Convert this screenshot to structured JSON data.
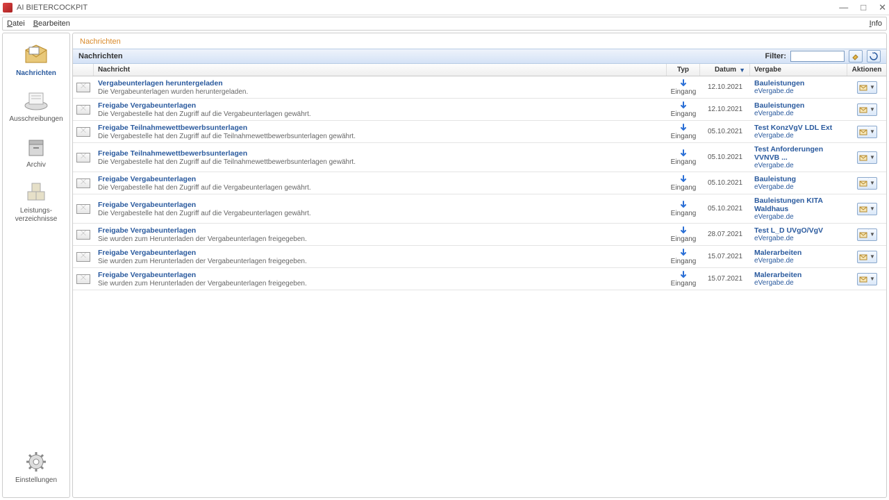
{
  "window": {
    "title": "AI BIETERCOCKPIT"
  },
  "menu": {
    "file": "Datei",
    "edit": "Bearbeiten",
    "info": "Info"
  },
  "sidebar": {
    "items": [
      {
        "label": "Nachrichten"
      },
      {
        "label": "Ausschreibungen"
      },
      {
        "label": "Archiv"
      },
      {
        "label": "Leistungs-\nverzeichnisse"
      }
    ],
    "settings": "Einstellungen"
  },
  "content": {
    "section_title": "Nachrichten",
    "panel_title": "Nachrichten",
    "filter_label": "Filter:",
    "filter_value": "",
    "columns": {
      "message": "Nachricht",
      "type": "Typ",
      "date": "Datum",
      "tender": "Vergabe",
      "actions": "Aktionen"
    }
  },
  "rows": [
    {
      "title": "Vergabeunterlagen heruntergeladen",
      "subtitle": "Die Vergabeunterlagen wurden heruntergeladen.",
      "type_label": "Eingang",
      "date": "12.10.2021",
      "tender": "Bauleistungen",
      "platform": "eVergabe.de"
    },
    {
      "title": "Freigabe Vergabeunterlagen",
      "subtitle": "Die Vergabestelle hat den Zugriff auf die Vergabeunterlagen gewährt.",
      "type_label": "Eingang",
      "date": "12.10.2021",
      "tender": "Bauleistungen",
      "platform": "eVergabe.de"
    },
    {
      "title": "Freigabe Teilnahmewettbewerbsunterlagen",
      "subtitle": "Die Vergabestelle hat den Zugriff auf die Teilnahmewettbewerbsunterlagen gewährt.",
      "type_label": "Eingang",
      "date": "05.10.2021",
      "tender": "Test KonzVgV LDL Ext",
      "platform": "eVergabe.de"
    },
    {
      "title": "Freigabe Teilnahmewettbewerbsunterlagen",
      "subtitle": "Die Vergabestelle hat den Zugriff auf die Teilnahmewettbewerbsunterlagen gewährt.",
      "type_label": "Eingang",
      "date": "05.10.2021",
      "tender": "Test Anforderungen VVNVB ...",
      "platform": "eVergabe.de"
    },
    {
      "title": "Freigabe Vergabeunterlagen",
      "subtitle": "Die Vergabestelle hat den Zugriff auf die Vergabeunterlagen gewährt.",
      "type_label": "Eingang",
      "date": "05.10.2021",
      "tender": "Bauleistung",
      "platform": "eVergabe.de"
    },
    {
      "title": "Freigabe Vergabeunterlagen",
      "subtitle": "Die Vergabestelle hat den Zugriff auf die Vergabeunterlagen gewährt.",
      "type_label": "Eingang",
      "date": "05.10.2021",
      "tender": "Bauleistungen KITA Waldhaus",
      "platform": "eVergabe.de"
    },
    {
      "title": "Freigabe Vergabeunterlagen",
      "subtitle": "Sie wurden zum Herunterladen der Vergabeunterlagen freigegeben.",
      "type_label": "Eingang",
      "date": "28.07.2021",
      "tender": "Test L_D UVgO/VgV",
      "platform": "eVergabe.de"
    },
    {
      "title": "Freigabe Vergabeunterlagen",
      "subtitle": "Sie wurden zum Herunterladen der Vergabeunterlagen freigegeben.",
      "type_label": "Eingang",
      "date": "15.07.2021",
      "tender": "Malerarbeiten",
      "platform": "eVergabe.de"
    },
    {
      "title": "Freigabe Vergabeunterlagen",
      "subtitle": "Sie wurden zum Herunterladen der Vergabeunterlagen freigegeben.",
      "type_label": "Eingang",
      "date": "15.07.2021",
      "tender": "Malerarbeiten",
      "platform": "eVergabe.de"
    }
  ]
}
